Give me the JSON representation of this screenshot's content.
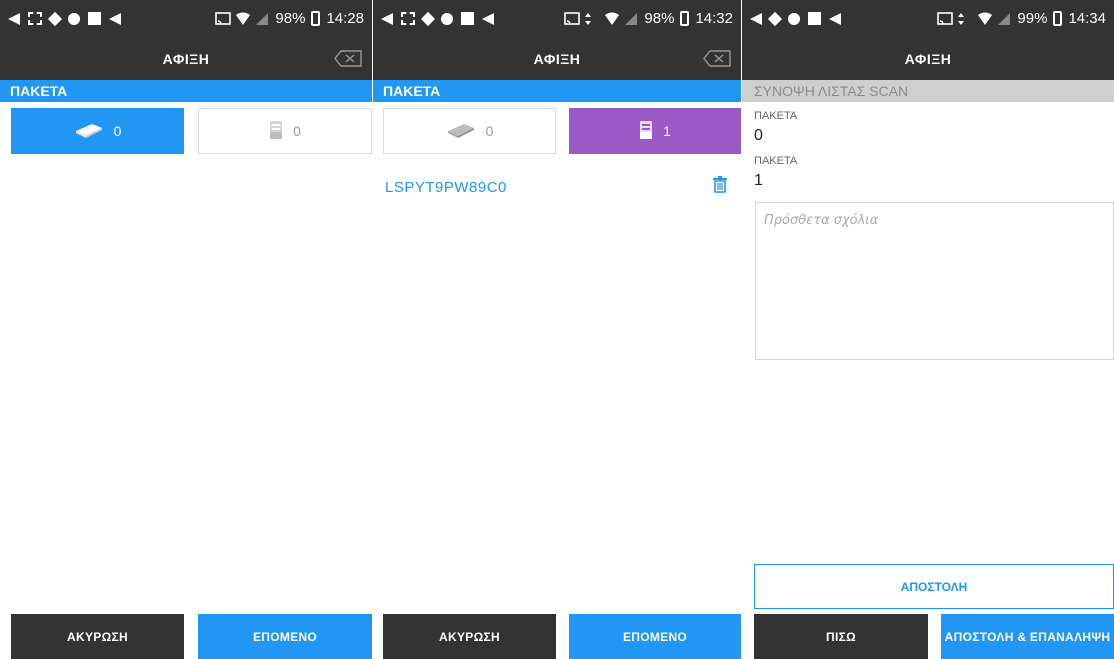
{
  "screens": [
    {
      "status": {
        "battery": "98%",
        "time": "14:28"
      },
      "title": "ΑΦΙΞΗ",
      "section": "ΠΑΚΕΤΑ",
      "counters": [
        {
          "icon": "package-icon",
          "count": "0",
          "state": "active"
        },
        {
          "icon": "scanned-box-icon",
          "count": "0",
          "state": "inactive"
        }
      ],
      "buttons": {
        "cancel": "ΑΚΥΡΩΣΗ",
        "next": "ΕΠΟΜΕΝΟ"
      }
    },
    {
      "status": {
        "battery": "98%",
        "time": "14:32"
      },
      "title": "ΑΦΙΞΗ",
      "section": "ΠΑΚΕΤΑ",
      "counters": [
        {
          "icon": "package-icon",
          "count": "0",
          "state": "inactive"
        },
        {
          "icon": "scanned-box-icon",
          "count": "1",
          "state": "active"
        }
      ],
      "scanned_items": [
        "LSPYT9PW89C0"
      ],
      "buttons": {
        "cancel": "ΑΚΥΡΩΣΗ",
        "next": "ΕΠΟΜΕΝΟ"
      }
    },
    {
      "status": {
        "battery": "99%",
        "time": "14:34"
      },
      "title": "ΑΦΙΞΗ",
      "section": "ΣΥΝΟΨΗ ΛΙΣΤΑΣ SCAN",
      "summary": [
        {
          "label": "ΠΑΚΕΤΑ",
          "value": "0"
        },
        {
          "label": "ΠΑΚΕΤΑ",
          "value": "1"
        }
      ],
      "comments_placeholder": "Πρόσθετα σχόλια",
      "buttons": {
        "send": "ΑΠΟΣΤΟΛΗ",
        "back": "ΠΙΣΩ",
        "send_repeat": "ΑΠΟΣΤΟΛΗ & ΕΠΑΝΑΛΗΨΗ"
      }
    }
  ],
  "colors": {
    "bar": "#333333",
    "accent_blue": "#2196f3",
    "accent_purple": "#9b59c6",
    "summary_header": "#cfcfcf"
  }
}
